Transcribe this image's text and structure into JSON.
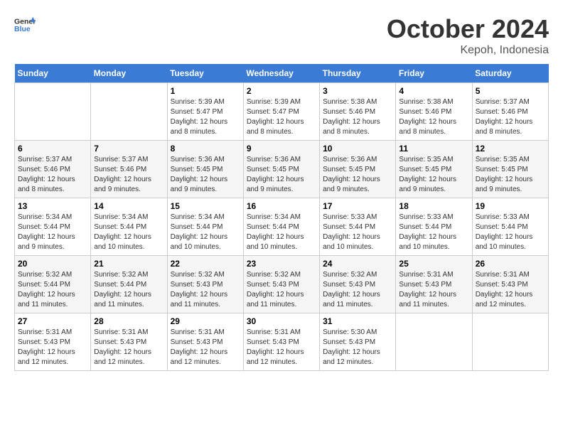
{
  "header": {
    "logo": {
      "general": "General",
      "blue": "Blue"
    },
    "title": "October 2024",
    "location": "Kepoh, Indonesia"
  },
  "calendar": {
    "days_of_week": [
      "Sunday",
      "Monday",
      "Tuesday",
      "Wednesday",
      "Thursday",
      "Friday",
      "Saturday"
    ],
    "weeks": [
      [
        {
          "day": "",
          "info": ""
        },
        {
          "day": "",
          "info": ""
        },
        {
          "day": "1",
          "info": "Sunrise: 5:39 AM\nSunset: 5:47 PM\nDaylight: 12 hours and 8 minutes."
        },
        {
          "day": "2",
          "info": "Sunrise: 5:39 AM\nSunset: 5:47 PM\nDaylight: 12 hours and 8 minutes."
        },
        {
          "day": "3",
          "info": "Sunrise: 5:38 AM\nSunset: 5:46 PM\nDaylight: 12 hours and 8 minutes."
        },
        {
          "day": "4",
          "info": "Sunrise: 5:38 AM\nSunset: 5:46 PM\nDaylight: 12 hours and 8 minutes."
        },
        {
          "day": "5",
          "info": "Sunrise: 5:37 AM\nSunset: 5:46 PM\nDaylight: 12 hours and 8 minutes."
        }
      ],
      [
        {
          "day": "6",
          "info": "Sunrise: 5:37 AM\nSunset: 5:46 PM\nDaylight: 12 hours and 8 minutes."
        },
        {
          "day": "7",
          "info": "Sunrise: 5:37 AM\nSunset: 5:46 PM\nDaylight: 12 hours and 9 minutes."
        },
        {
          "day": "8",
          "info": "Sunrise: 5:36 AM\nSunset: 5:45 PM\nDaylight: 12 hours and 9 minutes."
        },
        {
          "day": "9",
          "info": "Sunrise: 5:36 AM\nSunset: 5:45 PM\nDaylight: 12 hours and 9 minutes."
        },
        {
          "day": "10",
          "info": "Sunrise: 5:36 AM\nSunset: 5:45 PM\nDaylight: 12 hours and 9 minutes."
        },
        {
          "day": "11",
          "info": "Sunrise: 5:35 AM\nSunset: 5:45 PM\nDaylight: 12 hours and 9 minutes."
        },
        {
          "day": "12",
          "info": "Sunrise: 5:35 AM\nSunset: 5:45 PM\nDaylight: 12 hours and 9 minutes."
        }
      ],
      [
        {
          "day": "13",
          "info": "Sunrise: 5:34 AM\nSunset: 5:44 PM\nDaylight: 12 hours and 9 minutes."
        },
        {
          "day": "14",
          "info": "Sunrise: 5:34 AM\nSunset: 5:44 PM\nDaylight: 12 hours and 10 minutes."
        },
        {
          "day": "15",
          "info": "Sunrise: 5:34 AM\nSunset: 5:44 PM\nDaylight: 12 hours and 10 minutes."
        },
        {
          "day": "16",
          "info": "Sunrise: 5:34 AM\nSunset: 5:44 PM\nDaylight: 12 hours and 10 minutes."
        },
        {
          "day": "17",
          "info": "Sunrise: 5:33 AM\nSunset: 5:44 PM\nDaylight: 12 hours and 10 minutes."
        },
        {
          "day": "18",
          "info": "Sunrise: 5:33 AM\nSunset: 5:44 PM\nDaylight: 12 hours and 10 minutes."
        },
        {
          "day": "19",
          "info": "Sunrise: 5:33 AM\nSunset: 5:44 PM\nDaylight: 12 hours and 10 minutes."
        }
      ],
      [
        {
          "day": "20",
          "info": "Sunrise: 5:32 AM\nSunset: 5:44 PM\nDaylight: 12 hours and 11 minutes."
        },
        {
          "day": "21",
          "info": "Sunrise: 5:32 AM\nSunset: 5:44 PM\nDaylight: 12 hours and 11 minutes."
        },
        {
          "day": "22",
          "info": "Sunrise: 5:32 AM\nSunset: 5:43 PM\nDaylight: 12 hours and 11 minutes."
        },
        {
          "day": "23",
          "info": "Sunrise: 5:32 AM\nSunset: 5:43 PM\nDaylight: 12 hours and 11 minutes."
        },
        {
          "day": "24",
          "info": "Sunrise: 5:32 AM\nSunset: 5:43 PM\nDaylight: 12 hours and 11 minutes."
        },
        {
          "day": "25",
          "info": "Sunrise: 5:31 AM\nSunset: 5:43 PM\nDaylight: 12 hours and 11 minutes."
        },
        {
          "day": "26",
          "info": "Sunrise: 5:31 AM\nSunset: 5:43 PM\nDaylight: 12 hours and 12 minutes."
        }
      ],
      [
        {
          "day": "27",
          "info": "Sunrise: 5:31 AM\nSunset: 5:43 PM\nDaylight: 12 hours and 12 minutes."
        },
        {
          "day": "28",
          "info": "Sunrise: 5:31 AM\nSunset: 5:43 PM\nDaylight: 12 hours and 12 minutes."
        },
        {
          "day": "29",
          "info": "Sunrise: 5:31 AM\nSunset: 5:43 PM\nDaylight: 12 hours and 12 minutes."
        },
        {
          "day": "30",
          "info": "Sunrise: 5:31 AM\nSunset: 5:43 PM\nDaylight: 12 hours and 12 minutes."
        },
        {
          "day": "31",
          "info": "Sunrise: 5:30 AM\nSunset: 5:43 PM\nDaylight: 12 hours and 12 minutes."
        },
        {
          "day": "",
          "info": ""
        },
        {
          "day": "",
          "info": ""
        }
      ]
    ]
  }
}
